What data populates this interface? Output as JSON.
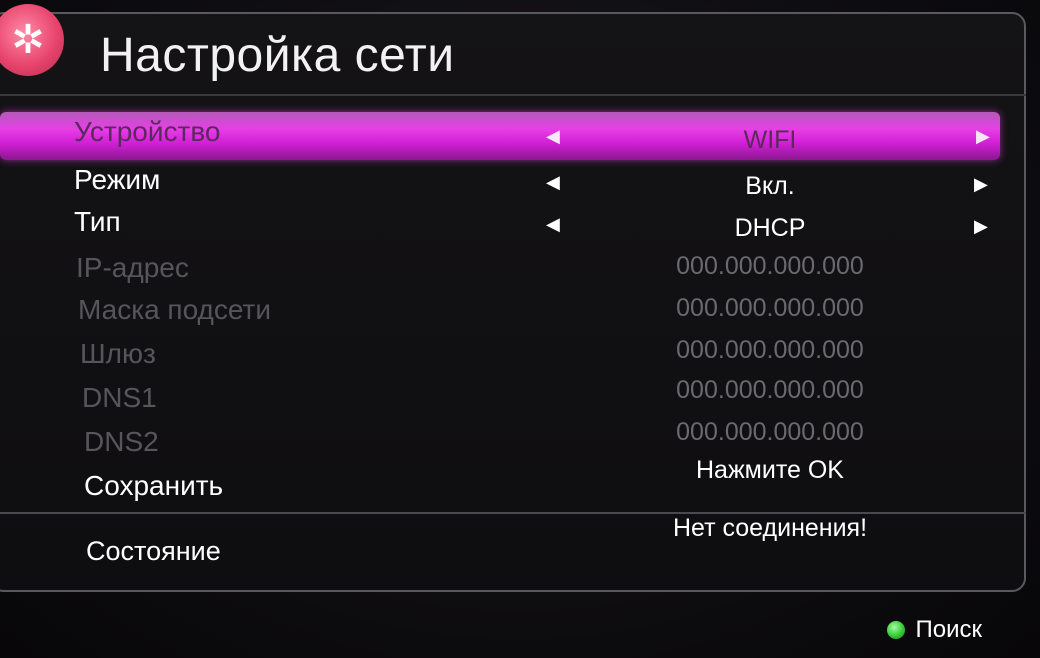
{
  "header": {
    "title": "Настройка сети",
    "icon": "gear-icon"
  },
  "rows": [
    {
      "label": "Устройство",
      "value": "WIFI",
      "selected": true,
      "arrows": true
    },
    {
      "label": "Режим",
      "value": "Вкл.",
      "arrows": true
    },
    {
      "label": "Тип",
      "value": "DHCP",
      "arrows": true
    },
    {
      "label": "IP-адрес",
      "value": "000.000.000.000",
      "disabled": true
    },
    {
      "label": "Маска подсети",
      "value": "000.000.000.000",
      "disabled": true
    },
    {
      "label": "Шлюз",
      "value": "000.000.000.000",
      "disabled": true
    },
    {
      "label": "DNS1",
      "value": "000.000.000.000",
      "disabled": true
    },
    {
      "label": "DNS2",
      "value": "000.000.000.000",
      "disabled": true
    },
    {
      "label": "Сохранить",
      "value": "Нажмите OK"
    }
  ],
  "status": {
    "label": "Состояние",
    "value": "Нет соединения!"
  },
  "footer": {
    "search_label": "Поиск",
    "search_color": "#2ec42e"
  },
  "colors": {
    "highlight": "#e63fe6",
    "gear": "#e8456d"
  }
}
